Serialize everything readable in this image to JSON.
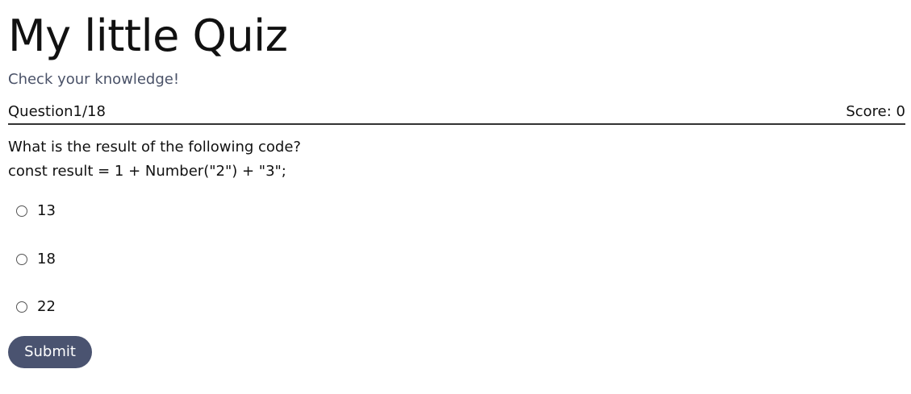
{
  "header": {
    "title": "My little Quiz",
    "subtitle": "Check your knowledge!"
  },
  "status": {
    "question_counter": "Question1/18",
    "score": "Score: 0"
  },
  "question": {
    "text": "What is the result of the following code?",
    "code": "const result = 1 + Number(\"2\") + \"3\";",
    "options": [
      {
        "label": "13",
        "selected": false
      },
      {
        "label": "18",
        "selected": false
      },
      {
        "label": "22",
        "selected": false
      }
    ]
  },
  "actions": {
    "submit_label": "Submit"
  },
  "colors": {
    "button_bg": "#4a5370",
    "subtitle": "#4a5268",
    "divider": "#333333"
  }
}
